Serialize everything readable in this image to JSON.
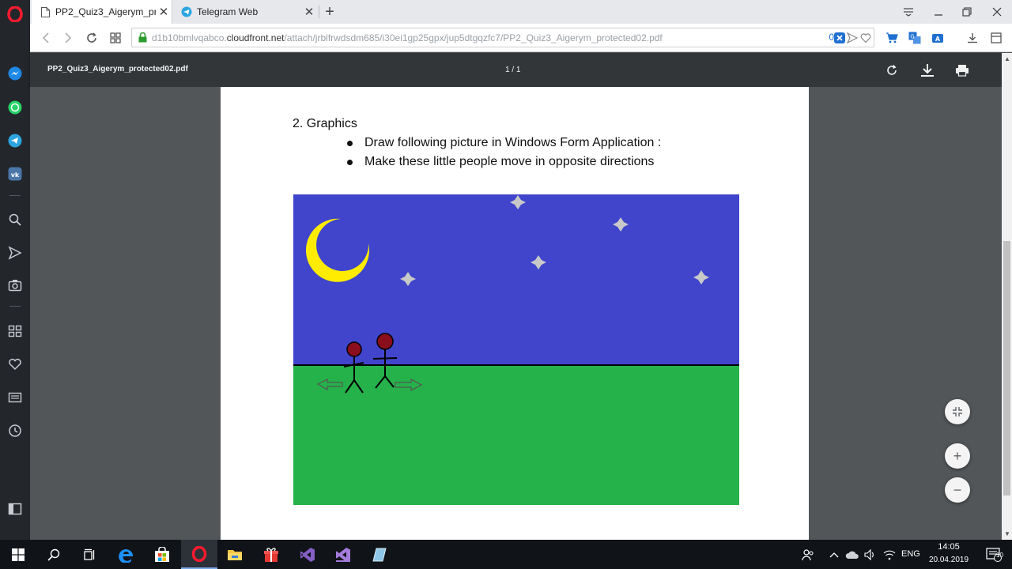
{
  "browser": {
    "tabs": [
      {
        "label": "PP2_Quiz3_Aigerym_prote",
        "active": true,
        "close": "✕"
      },
      {
        "label": "Telegram Web",
        "active": false,
        "close": "✕"
      }
    ],
    "new_tab": "+",
    "window_controls": [
      "minimize",
      "restore",
      "close"
    ]
  },
  "addressbar": {
    "url_prefix": "d1b10bmlvqabco.",
    "url_host": "cloudfront.net",
    "url_path": "/attach/jrblfrwdsdm685/i30ei1gp25gpx/jup5dtgqzfc7/PP2_Quiz3_Aigerym_protected02.pdf",
    "ad_block_count": "0"
  },
  "pdf_toolbar": {
    "filename": "PP2_Quiz3_Aigerym_protected02.pdf",
    "page_indicator": "1 / 1"
  },
  "document": {
    "heading": "2. Graphics",
    "bullets": [
      "Draw following picture in Windows Form Application :",
      "Make these little people move in opposite directions"
    ]
  },
  "picture": {
    "sky_color": "#4045cc",
    "grass_color": "#25b24a",
    "moon_color": "#ffec00",
    "star_color": "#c0c0c0",
    "head_color": "#8a0e1c"
  },
  "zoom": {
    "fit": "fit-to-page",
    "zoom_in": "+",
    "zoom_out": "−"
  },
  "taskbar": {
    "language": "ENG",
    "time": "14:05",
    "date": "20.04.2019",
    "notification_count": "10"
  }
}
